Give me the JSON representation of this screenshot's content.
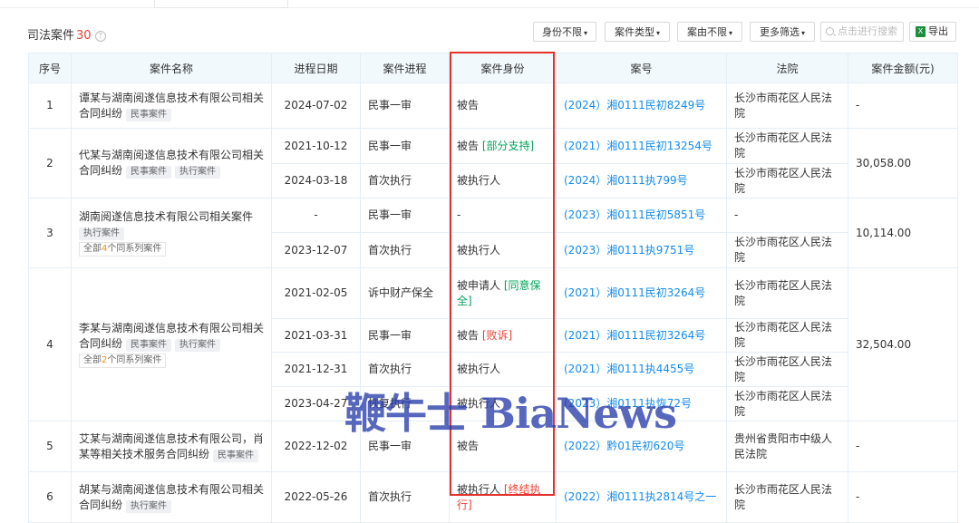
{
  "section": {
    "title": "司法案件",
    "count": "30",
    "info_icon": "info-icon"
  },
  "toolbar": {
    "filters": [
      "身份不限",
      "案件类型",
      "案由不限",
      "更多筛选"
    ],
    "search_placeholder": "点击进行搜索",
    "export_label": "导出",
    "export_icon": "X"
  },
  "columns": [
    "序号",
    "案件名称",
    "进程日期",
    "案件进程",
    "案件身份",
    "案号",
    "法院",
    "案件金额(元)"
  ],
  "cases": [
    {
      "no": "1",
      "name": "谭某与湖南阅遂信息技术有限公司相关合同纠纷",
      "tags": [
        "民事案件"
      ],
      "series": null,
      "amount": "-",
      "rows": [
        {
          "date": "2024-07-02",
          "stage": "民事一审",
          "role": "被告",
          "role_note": "",
          "case_no": "(2024）湘0111民初8249号",
          "court": "长沙市雨花区人民法院"
        }
      ]
    },
    {
      "no": "2",
      "name": "代某与湖南阅遂信息技术有限公司相关合同纠纷",
      "tags": [
        "民事案件",
        "执行案件"
      ],
      "series": null,
      "amount": "30,058.00",
      "rows": [
        {
          "date": "2021-10-12",
          "stage": "民事一审",
          "role": "被告",
          "role_note": "[部分支持]",
          "case_no": "(2021）湘0111民初13254号",
          "court": "长沙市雨花区人民法院"
        },
        {
          "date": "2024-03-18",
          "stage": "首次执行",
          "role": "被执行人",
          "role_note": "",
          "case_no": "(2024）湘0111执799号",
          "court": "长沙市雨花区人民法院"
        }
      ]
    },
    {
      "no": "3",
      "name": "湖南阅遂信息技术有限公司相关案件",
      "tags": [
        "执行案件"
      ],
      "series": {
        "pre": "全部",
        "n": "4",
        "post": "个同系列案件"
      },
      "amount": "10,114.00",
      "rows": [
        {
          "date": "-",
          "stage": "民事一审",
          "role": "-",
          "role_note": "",
          "case_no": "(2023）湘0111民初5851号",
          "court": "-"
        },
        {
          "date": "2023-12-07",
          "stage": "首次执行",
          "role": "被执行人",
          "role_note": "",
          "case_no": "(2023）湘0111执9751号",
          "court": "长沙市雨花区人民法院"
        }
      ]
    },
    {
      "no": "4",
      "name": "李某与湖南阅遂信息技术有限公司相关合同纠纷",
      "tags": [
        "民事案件",
        "执行案件"
      ],
      "series": {
        "pre": "全部",
        "n": "2",
        "post": "个同系列案件"
      },
      "amount": "32,504.00",
      "rows": [
        {
          "date": "2021-02-05",
          "stage": "诉中财产保全",
          "role": "被申请人",
          "role_note": "[同意保全]",
          "case_no": "(2021）湘0111民初3264号",
          "court": "长沙市雨花区人民法院"
        },
        {
          "date": "2021-03-31",
          "stage": "民事一审",
          "role": "被告",
          "role_note": "[败诉]",
          "case_no": "(2021）湘0111民初3264号",
          "court": "长沙市雨花区人民法院"
        },
        {
          "date": "2021-12-31",
          "stage": "首次执行",
          "role": "被执行人",
          "role_note": "",
          "case_no": "(2021）湘0111执4455号",
          "court": "长沙市雨花区人民法院"
        },
        {
          "date": "2023-04-27",
          "stage": "恢复执行",
          "role": "被执行人",
          "role_note": "",
          "case_no": "(2023）湘0111执恢72号",
          "court": "长沙市雨花区人民法院"
        }
      ]
    },
    {
      "no": "5",
      "name": "艾某与湖南阅遂信息技术有限公司，肖某等相关技术服务合同纠纷",
      "tags": [
        "民事案件"
      ],
      "series": null,
      "amount": "-",
      "rows": [
        {
          "date": "2022-12-02",
          "stage": "民事一审",
          "role": "被告",
          "role_note": "",
          "case_no": "(2022）黔01民初620号",
          "court": "贵州省贵阳市中级人民法院"
        }
      ]
    },
    {
      "no": "6",
      "name": "胡某与湖南阅遂信息技术有限公司相关合同纠纷",
      "tags": [
        "执行案件"
      ],
      "series": null,
      "amount": "-",
      "rows": [
        {
          "date": "2022-05-26",
          "stage": "首次执行",
          "role": "被执行人",
          "role_note": "[终结执行]",
          "case_no": "(2022）湘0111执2814号之一",
          "court": "长沙市雨花区人民法院"
        }
      ]
    }
  ],
  "watermark": "鞭牛士 BiaNews",
  "colors": {
    "link": "#128bed",
    "highlight_box": "#e3312d",
    "note_green": "#00a35a",
    "note_red": "#f04134",
    "count": "#f04134",
    "header_bg": "#f2f9fc"
  }
}
